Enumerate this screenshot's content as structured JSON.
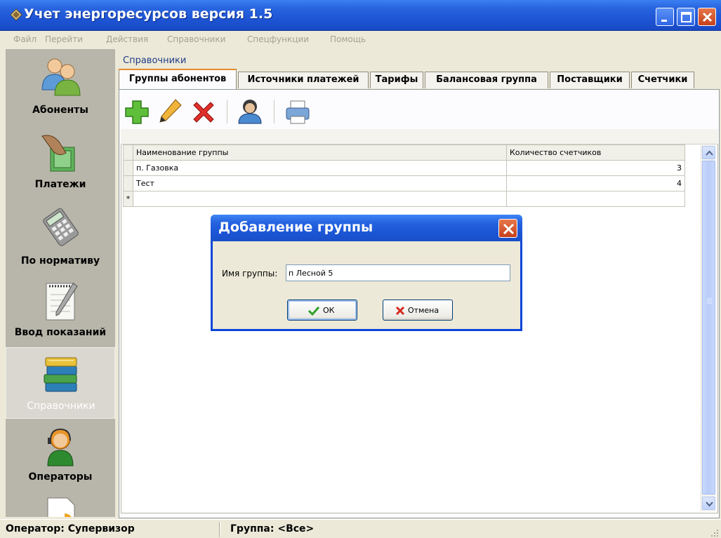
{
  "window": {
    "title": "Учет энергоресурсов версия 1.5"
  },
  "menu": [
    "Файл",
    "Перейти",
    "Действия",
    "Справочники",
    "Спецфункции",
    "Помощь"
  ],
  "sidebar": {
    "items": [
      {
        "label": "Абоненты",
        "icon": "subscribers-icon"
      },
      {
        "label": "Платежи",
        "icon": "payments-icon"
      },
      {
        "label": "По нормативу",
        "icon": "calculator-icon"
      },
      {
        "label": "Ввод показаний",
        "icon": "notepad-icon"
      },
      {
        "label": "Справочники",
        "icon": "books-icon",
        "active": true
      },
      {
        "label": "Операторы",
        "icon": "operator-icon"
      }
    ]
  },
  "section_title": "Справочники",
  "tabs": [
    "Группы абонентов",
    "Источники платежей",
    "Тарифы",
    "Балансовая группа",
    "Поставщики",
    "Счетчики"
  ],
  "toolbar": [
    "add-icon",
    "edit-icon",
    "delete-icon",
    "users-icon",
    "print-icon"
  ],
  "grid": {
    "columns": [
      "Наименование группы",
      "Количество счетчиков"
    ],
    "rows": [
      {
        "name": "п. Газовка",
        "count": "3"
      },
      {
        "name": "Тест",
        "count": "4"
      }
    ],
    "new_row_marker": "*"
  },
  "dialog": {
    "title": "Добавление группы",
    "label": "Имя группы:",
    "value": "п Лесной 5",
    "ok": "ОК",
    "cancel": "Отмена"
  },
  "status": {
    "operator": "Оператор: Супервизор",
    "group": "Группа: <Все>"
  },
  "colors": {
    "titlebar": "#2a66e0",
    "sidebar": "#b8b6aa",
    "tab_accent": "#e68b2c",
    "dialog_border": "#0a46d8"
  }
}
